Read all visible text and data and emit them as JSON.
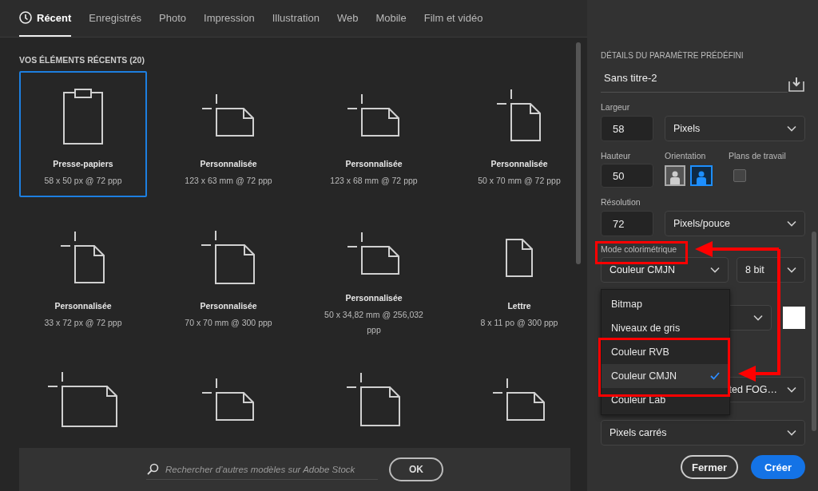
{
  "tabs": [
    {
      "label": "Récent",
      "selected": true
    },
    {
      "label": "Enregistrés",
      "selected": false
    },
    {
      "label": "Photo",
      "selected": false
    },
    {
      "label": "Impression",
      "selected": false
    },
    {
      "label": "Illustration",
      "selected": false
    },
    {
      "label": "Web",
      "selected": false
    },
    {
      "label": "Mobile",
      "selected": false
    },
    {
      "label": "Film et vidéo",
      "selected": false
    }
  ],
  "recent": {
    "heading": "VOS ÉLÉMENTS RÉCENTS (20)",
    "items": [
      {
        "kind": "clipboard",
        "name": "Presse-papiers",
        "size": "58 x 50 px @ 72 ppp",
        "selected": true
      },
      {
        "kind": "landscape",
        "name": "Personnalisée",
        "size": "123 x 63 mm @ 72 ppp",
        "selected": false
      },
      {
        "kind": "landscape",
        "name": "Personnalisée",
        "size": "123 x 68 mm @ 72 ppp",
        "selected": false
      },
      {
        "kind": "portrait",
        "name": "Personnalisée",
        "size": "50 x 70 mm @ 72 ppp",
        "selected": false
      },
      {
        "kind": "portrait",
        "name": "Personnalisée",
        "size": "33 x 72 px @ 72 ppp",
        "selected": false
      },
      {
        "kind": "square",
        "name": "Personnalisée",
        "size": "70 x 70 mm @ 300 ppp",
        "selected": false
      },
      {
        "kind": "landscape",
        "name": "Personnalisée",
        "size": "50 x 34,82 mm @ 256,032 ppp",
        "selected": false
      },
      {
        "kind": "letter",
        "name": "Lettre",
        "size": "8 x 11 po @ 300 ppp",
        "selected": false
      },
      {
        "kind": "big",
        "selected": false
      },
      {
        "kind": "landscape",
        "selected": false
      },
      {
        "kind": "square",
        "selected": false
      },
      {
        "kind": "landscape",
        "selected": false
      }
    ]
  },
  "search": {
    "placeholder": "Rechercher d’autres modèles sur Adobe Stock",
    "button": "OK"
  },
  "details": {
    "heading": "DÉTAILS DU PARAMÈTRE PRÉDÉFINI",
    "name": "Sans titre-2",
    "width": {
      "label": "Largeur",
      "value": "58",
      "unit": "Pixels"
    },
    "height": {
      "label": "Hauteur",
      "value": "50"
    },
    "orientation": {
      "label": "Orientation",
      "options": [
        {
          "kind": "portrait",
          "selected": false
        },
        {
          "kind": "landscape",
          "selected": true
        }
      ]
    },
    "artboards": {
      "label": "Plans de travail",
      "checked": false
    },
    "resolution": {
      "label": "Résolution",
      "value": "72",
      "unit": "Pixels/pouce"
    },
    "color_mode": {
      "label": "Mode colorimétrique",
      "value": "Couleur CMJN",
      "depth": "8 bit",
      "menu": [
        {
          "label": "Bitmap",
          "selected": false
        },
        {
          "label": "Niveaux de gris",
          "selected": false
        },
        {
          "label": "Couleur RVB",
          "selected": false
        },
        {
          "label": "Couleur CMJN",
          "selected": true
        },
        {
          "label": "Couleur Lab",
          "selected": false
        }
      ]
    },
    "profile": {
      "value": "ted FOG…"
    },
    "pixel_format": {
      "value": "Pixels carrés"
    },
    "buttons": [
      {
        "label": "Fermer",
        "kind": "secondary"
      },
      {
        "label": "Créer",
        "kind": "primary"
      }
    ]
  },
  "annotations": [
    {
      "kind": "label-box"
    },
    {
      "kind": "menu-box"
    },
    {
      "kind": "arrows"
    }
  ]
}
